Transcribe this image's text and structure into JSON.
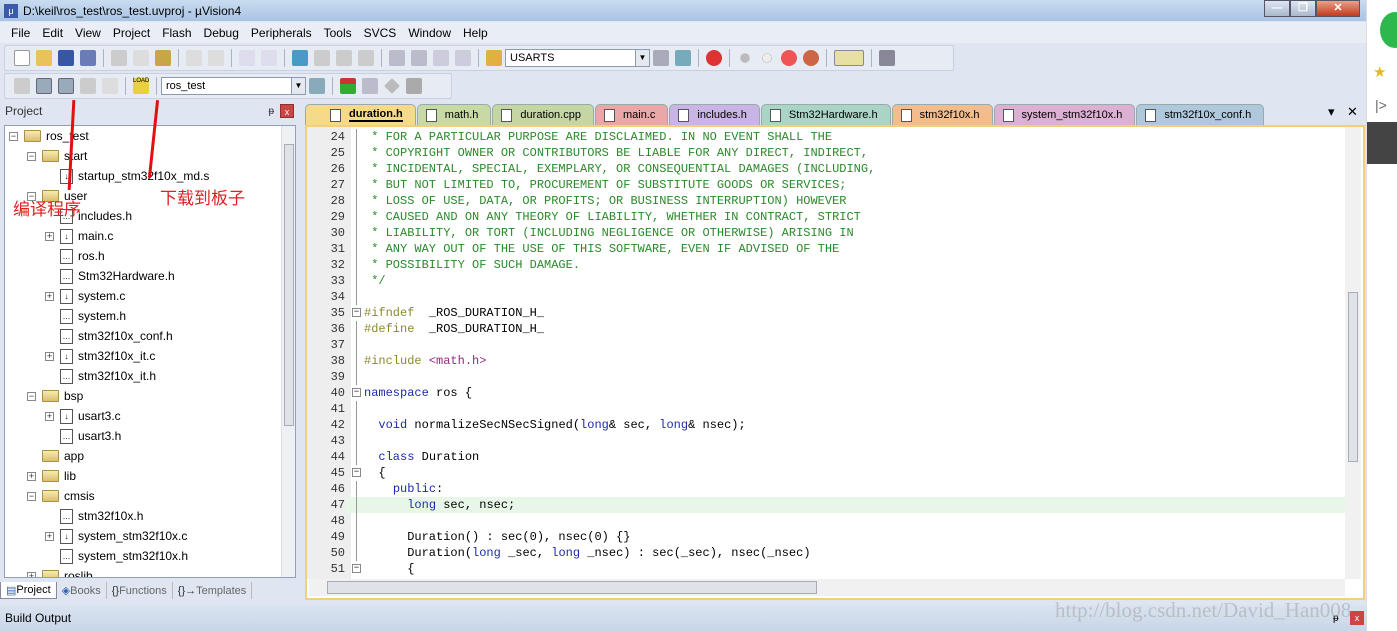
{
  "window": {
    "title": "D:\\keil\\ros_test\\ros_test.uvproj - µVision4",
    "minimize": "—",
    "maximize": "❐",
    "close": "✕"
  },
  "menu": [
    "File",
    "Edit",
    "View",
    "Project",
    "Flash",
    "Debug",
    "Peripherals",
    "Tools",
    "SVCS",
    "Window",
    "Help"
  ],
  "toolbar": {
    "find_combo": "USARTS",
    "target_combo": "ros_test",
    "load_label": "LOAD"
  },
  "project_panel": {
    "title": "Project",
    "pin": "ᵽ",
    "close": "x",
    "tree": [
      {
        "label": "ros_test",
        "level": 0,
        "type": "root",
        "toggle": "-"
      },
      {
        "label": "start",
        "level": 1,
        "type": "folder",
        "toggle": "-"
      },
      {
        "label": "startup_stm32f10x_md.s",
        "level": 2,
        "type": "file-src",
        "toggle": ""
      },
      {
        "label": "user",
        "level": 1,
        "type": "folder",
        "toggle": "-"
      },
      {
        "label": "includes.h",
        "level": 2,
        "type": "file",
        "toggle": ""
      },
      {
        "label": "main.c",
        "level": 2,
        "type": "file-src",
        "toggle": "+"
      },
      {
        "label": "ros.h",
        "level": 2,
        "type": "file",
        "toggle": ""
      },
      {
        "label": "Stm32Hardware.h",
        "level": 2,
        "type": "file",
        "toggle": ""
      },
      {
        "label": "system.c",
        "level": 2,
        "type": "file-src",
        "toggle": "+"
      },
      {
        "label": "system.h",
        "level": 2,
        "type": "file",
        "toggle": ""
      },
      {
        "label": "stm32f10x_conf.h",
        "level": 2,
        "type": "file",
        "toggle": ""
      },
      {
        "label": "stm32f10x_it.c",
        "level": 2,
        "type": "file-src",
        "toggle": "+"
      },
      {
        "label": "stm32f10x_it.h",
        "level": 2,
        "type": "file",
        "toggle": ""
      },
      {
        "label": "bsp",
        "level": 1,
        "type": "folder",
        "toggle": "-"
      },
      {
        "label": "usart3.c",
        "level": 2,
        "type": "file-src",
        "toggle": "+"
      },
      {
        "label": "usart3.h",
        "level": 2,
        "type": "file",
        "toggle": ""
      },
      {
        "label": "app",
        "level": 1,
        "type": "folder",
        "toggle": ""
      },
      {
        "label": "lib",
        "level": 1,
        "type": "folder",
        "toggle": "+"
      },
      {
        "label": "cmsis",
        "level": 1,
        "type": "folder",
        "toggle": "-"
      },
      {
        "label": "stm32f10x.h",
        "level": 2,
        "type": "file",
        "toggle": ""
      },
      {
        "label": "system_stm32f10x.c",
        "level": 2,
        "type": "file-src",
        "toggle": "+"
      },
      {
        "label": "system_stm32f10x.h",
        "level": 2,
        "type": "file",
        "toggle": ""
      },
      {
        "label": "roslib",
        "level": 1,
        "type": "folder",
        "toggle": "+"
      }
    ],
    "bottom_tabs": [
      "Project",
      "Books",
      "Functions",
      "Templates"
    ]
  },
  "annotations": {
    "compile": "编译程序",
    "download": "下载到板子"
  },
  "editor_tabs": [
    {
      "label": "duration.h",
      "color": "#f7d98a",
      "active": true
    },
    {
      "label": "math.h",
      "color": "#c7d9a4"
    },
    {
      "label": "duration.cpp",
      "color": "#c5d6a5"
    },
    {
      "label": "main.c",
      "color": "#eba7a7"
    },
    {
      "label": "includes.h",
      "color": "#c8b5e6"
    },
    {
      "label": "Stm32Hardware.h",
      "color": "#a9d4c6"
    },
    {
      "label": "stm32f10x.h",
      "color": "#f3bc8c"
    },
    {
      "label": "system_stm32f10x.h",
      "color": "#dcb0d2"
    },
    {
      "label": "stm32f10x_conf.h",
      "color": "#b0c8dc"
    }
  ],
  "editor_tab_controls": {
    "menu": "▾",
    "close": "✕"
  },
  "code": {
    "current_line": 47,
    "lines": [
      {
        "n": "24",
        "seg": [
          [
            "comment",
            " * FOR A PARTICULAR PURPOSE ARE DISCLAIMED. IN NO EVENT SHALL THE"
          ]
        ]
      },
      {
        "n": "25",
        "seg": [
          [
            "comment",
            " * COPYRIGHT OWNER OR CONTRIBUTORS BE LIABLE FOR ANY DIRECT, INDIRECT,"
          ]
        ]
      },
      {
        "n": "26",
        "seg": [
          [
            "comment",
            " * INCIDENTAL, SPECIAL, EXEMPLARY, OR CONSEQUENTIAL DAMAGES (INCLUDING,"
          ]
        ]
      },
      {
        "n": "27",
        "seg": [
          [
            "comment",
            " * BUT NOT LIMITED TO, PROCUREMENT OF SUBSTITUTE GOODS OR SERVICES;"
          ]
        ]
      },
      {
        "n": "28",
        "seg": [
          [
            "comment",
            " * LOSS OF USE, DATA, OR PROFITS; OR BUSINESS INTERRUPTION) HOWEVER"
          ]
        ]
      },
      {
        "n": "29",
        "seg": [
          [
            "comment",
            " * CAUSED AND ON ANY THEORY OF LIABILITY, WHETHER IN CONTRACT, STRICT"
          ]
        ]
      },
      {
        "n": "30",
        "seg": [
          [
            "comment",
            " * LIABILITY, OR TORT (INCLUDING NEGLIGENCE OR OTHERWISE) ARISING IN"
          ]
        ]
      },
      {
        "n": "31",
        "seg": [
          [
            "comment",
            " * ANY WAY OUT OF THE USE OF THIS SOFTWARE, EVEN IF ADVISED OF THE"
          ]
        ]
      },
      {
        "n": "32",
        "seg": [
          [
            "comment",
            " * POSSIBILITY OF SUCH DAMAGE."
          ]
        ]
      },
      {
        "n": "33",
        "seg": [
          [
            "comment",
            " */"
          ]
        ]
      },
      {
        "n": "34",
        "seg": []
      },
      {
        "n": "35",
        "fold": "-",
        "seg": [
          [
            "pp",
            "#ifndef"
          ],
          [
            "",
            "  _ROS_DURATION_H_"
          ]
        ]
      },
      {
        "n": "36",
        "seg": [
          [
            "pp",
            "#define"
          ],
          [
            "",
            "  _ROS_DURATION_H_"
          ]
        ]
      },
      {
        "n": "37",
        "seg": []
      },
      {
        "n": "38",
        "seg": [
          [
            "pp",
            "#include "
          ],
          [
            "str",
            "<math.h>"
          ]
        ]
      },
      {
        "n": "39",
        "seg": []
      },
      {
        "n": "40",
        "fold": "-",
        "seg": [
          [
            "kw",
            "namespace"
          ],
          [
            "",
            " ros {"
          ]
        ]
      },
      {
        "n": "41",
        "seg": []
      },
      {
        "n": "42",
        "seg": [
          [
            "",
            "  "
          ],
          [
            "kw",
            "void"
          ],
          [
            "",
            " normalizeSecNSecSigned("
          ],
          [
            "kw",
            "long"
          ],
          [
            "",
            "& sec, "
          ],
          [
            "kw",
            "long"
          ],
          [
            "",
            "& nsec);"
          ]
        ]
      },
      {
        "n": "43",
        "seg": []
      },
      {
        "n": "44",
        "seg": [
          [
            "",
            "  "
          ],
          [
            "kw",
            "class"
          ],
          [
            "",
            " Duration"
          ]
        ]
      },
      {
        "n": "45",
        "fold": "-",
        "seg": [
          [
            "",
            "  {"
          ]
        ]
      },
      {
        "n": "46",
        "seg": [
          [
            "",
            "    "
          ],
          [
            "kw",
            "public"
          ],
          [
            "",
            ":"
          ]
        ]
      },
      {
        "n": "47",
        "seg": [
          [
            "",
            "      "
          ],
          [
            "kw",
            "long"
          ],
          [
            "",
            " sec, nsec;"
          ]
        ]
      },
      {
        "n": "48",
        "seg": []
      },
      {
        "n": "49",
        "seg": [
          [
            "",
            "      Duration() : sec(0), nsec(0) {}"
          ]
        ]
      },
      {
        "n": "50",
        "seg": [
          [
            "",
            "      Duration("
          ],
          [
            "kw",
            "long"
          ],
          [
            "",
            " _sec, "
          ],
          [
            "kw",
            "long"
          ],
          [
            "",
            " _nsec) : sec(_sec), nsec(_nsec)"
          ]
        ]
      },
      {
        "n": "51",
        "fold": "-",
        "seg": [
          [
            "",
            "      {"
          ]
        ]
      }
    ]
  },
  "build_output": {
    "title": "Build Output"
  },
  "watermark": "http://blog.csdn.net/David_Han008"
}
